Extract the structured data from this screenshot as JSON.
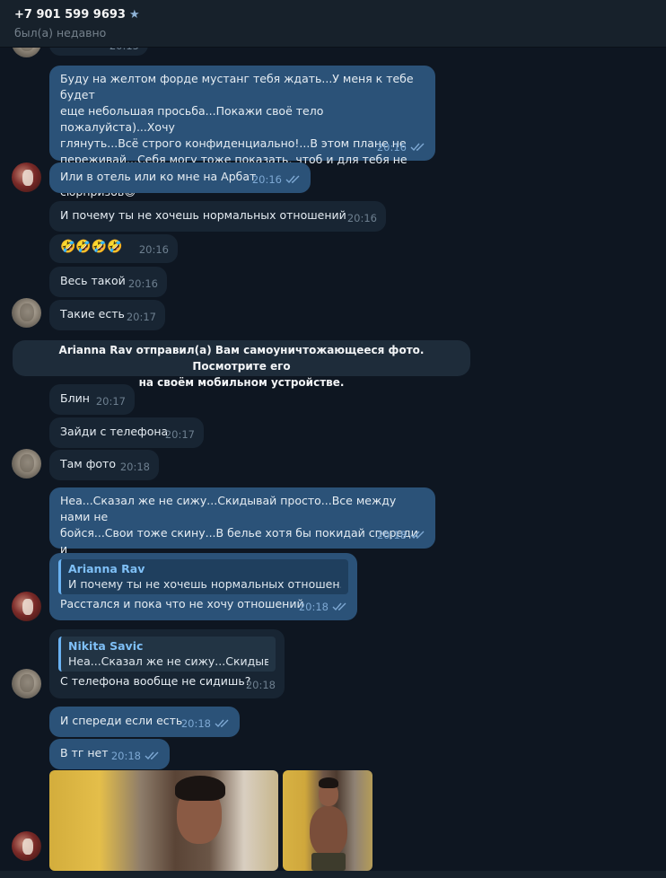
{
  "header": {
    "phone": "+7 901 599 9693",
    "star_icon": "star-icon",
    "status": "был(а) недавно"
  },
  "messages": {
    "m0": {
      "time": "20:15"
    },
    "m1": {
      "text": "Буду на желтом форде мустанг тебя ждать...У меня к тебе будет\nеще небольшая просьба...Покажи своё тело пожалуйста)...Хочу\nглянуть...Всё строго конфиденциально!...В этом плане не\nпереживай...Себя могу тоже показать, чтоб и для тебя не было\nсюрпризов",
      "emoji": "😊",
      "time": "20:16"
    },
    "m2": {
      "text": "Или в отель или ко мне на Арбат",
      "time": "20:16"
    },
    "m3": {
      "text": "И почему ты не хочешь нормальных отношений",
      "time": "20:16"
    },
    "m4": {
      "text": "🤣🤣🤣🤣",
      "time": "20:16"
    },
    "m5": {
      "text": "Весь такой",
      "time": "20:16"
    },
    "m6": {
      "text": "Такие есть",
      "time": "20:17"
    },
    "service": "Arianna Rav отправил(а) Вам самоуничтожающееся фото. Посмотрите его\nна своём мобильном устройстве.",
    "m7": {
      "text": "Блин",
      "time": "20:17"
    },
    "m8": {
      "text": "Зайди с телефона",
      "time": "20:17"
    },
    "m9": {
      "text": "Там фото",
      "time": "20:18"
    },
    "m10": {
      "text": "Неа...Сказал же не сижу...Скидывай просто...Все между нами не\nбойся...Свои тоже скину...В белье хотя бы покидай спереди и\nсзади",
      "time": "20:18"
    },
    "m11": {
      "quote_name": "Arianna Rav",
      "quote_text": "И почему ты не хочешь нормальных отношен...",
      "text": "Расстался и пока что не хочу отношений",
      "time": "20:18"
    },
    "m12": {
      "quote_name": "Nikita Savic",
      "quote_text": "Неа...Сказал же не сижу...Скидыва...",
      "text": "С телефона вообще не сидишь?",
      "time": "20:18"
    },
    "m13": {
      "text": "И спереди если есть",
      "time": "20:18"
    },
    "m14": {
      "text": "В тг нет",
      "time": "20:18"
    }
  },
  "colors": {
    "background": "#0e1621",
    "incoming_bubble": "#182533",
    "outgoing_bubble": "#2b5278",
    "accent": "#6ab2f2"
  }
}
